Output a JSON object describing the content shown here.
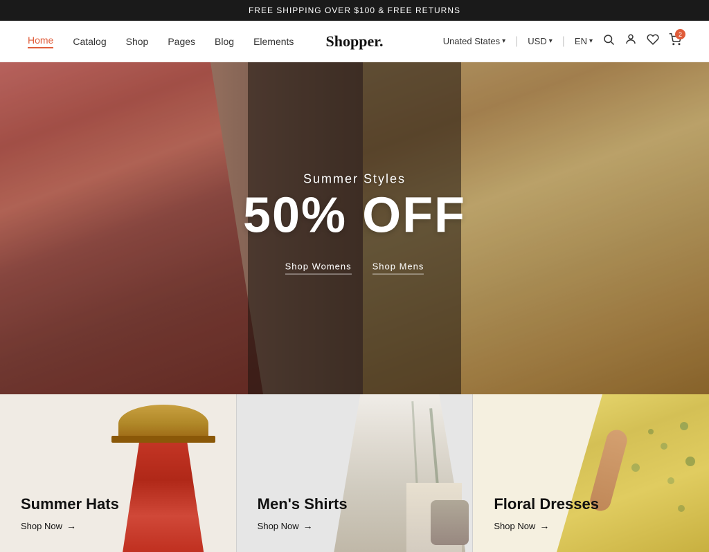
{
  "banner": {
    "text": "FREE SHIPPING OVER $100 & FREE RETURNS"
  },
  "header": {
    "logo": "Shopper.",
    "nav": {
      "items": [
        {
          "label": "Home",
          "active": true
        },
        {
          "label": "Catalog",
          "active": false
        },
        {
          "label": "Shop",
          "active": false
        },
        {
          "label": "Pages",
          "active": false
        },
        {
          "label": "Blog",
          "active": false
        },
        {
          "label": "Elements",
          "active": false
        }
      ]
    },
    "region": "Unated States",
    "currency": "USD",
    "language": "EN",
    "cart_count": "2"
  },
  "hero": {
    "subtitle": "Summer Styles",
    "title": "50% OFF",
    "btn_womens": "Shop Womens",
    "btn_mens": "Shop Mens"
  },
  "categories": [
    {
      "title": "Summer Hats",
      "link_text": "Shop Now",
      "arrow": "→"
    },
    {
      "title": "Men's Shirts",
      "link_text": "Shop Now",
      "arrow": "→"
    },
    {
      "title": "Floral Dresses",
      "link_text": "Shop Now",
      "arrow": "→"
    }
  ],
  "icons": {
    "search": "🔍",
    "account": "👤",
    "wishlist": "♡",
    "cart": "🛒",
    "chevron": "▾"
  }
}
